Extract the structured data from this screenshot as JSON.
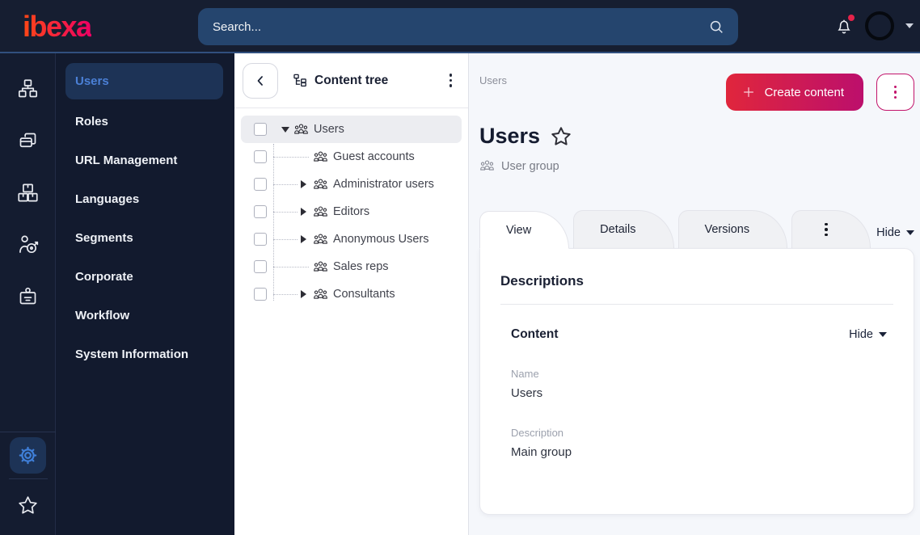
{
  "colors": {
    "topbar_bg": "#161e31",
    "topbar_divider": "#31507f",
    "rail_bg": "#141c30",
    "sidebar_bg": "#121a2e",
    "active_item_bg": "#1d3356",
    "active_item_text": "#4b80d6",
    "brand_gradient_start": "#ff4716",
    "brand_gradient_end": "#ed0064",
    "button_gradient_start": "#e0263c",
    "button_gradient_end": "#bc0f6c",
    "accent_magenta": "#c2136b",
    "notification_dot": "#e5234a",
    "main_bg": "#f5f7fb",
    "tree_selected_bg": "#ecedf1"
  },
  "topbar": {
    "logo_text": "ibexa",
    "search_placeholder": "Search...",
    "icons": [
      "search-icon",
      "bell-icon",
      "avatar",
      "chevron-down-icon"
    ]
  },
  "icon_rail": {
    "items": [
      {
        "icon": "sitemap-icon"
      },
      {
        "icon": "pages-icon"
      },
      {
        "icon": "packages-icon"
      },
      {
        "icon": "personalization-target-icon"
      },
      {
        "icon": "id-badge-icon"
      }
    ],
    "bottom": [
      {
        "icon": "gear-icon",
        "active": true
      },
      {
        "icon": "star-icon"
      }
    ]
  },
  "sidebar": {
    "items": [
      {
        "label": "Users",
        "active": true
      },
      {
        "label": "Roles"
      },
      {
        "label": "URL Management"
      },
      {
        "label": "Languages"
      },
      {
        "label": "Segments"
      },
      {
        "label": "Corporate"
      },
      {
        "label": "Workflow"
      },
      {
        "label": "System Information"
      }
    ]
  },
  "content_tree": {
    "title": "Content tree",
    "items": [
      {
        "label": "Users",
        "depth": 0,
        "state": "expanded",
        "selected": true,
        "icon": "user-group-icon"
      },
      {
        "label": "Guest accounts",
        "depth": 1,
        "state": "leaf",
        "icon": "user-group-icon"
      },
      {
        "label": "Administrator users",
        "depth": 1,
        "state": "collapsed",
        "icon": "user-group-icon"
      },
      {
        "label": "Editors",
        "depth": 1,
        "state": "collapsed",
        "icon": "user-group-icon"
      },
      {
        "label": "Anonymous Users",
        "depth": 1,
        "state": "collapsed",
        "icon": "user-group-icon"
      },
      {
        "label": "Sales reps",
        "depth": 1,
        "state": "leaf",
        "icon": "user-group-icon"
      },
      {
        "label": "Consultants",
        "depth": 1,
        "state": "collapsed",
        "icon": "user-group-icon"
      }
    ]
  },
  "main": {
    "breadcrumb": "Users",
    "create_button_label": "Create content",
    "page_title": "Users",
    "content_type_label": "User group",
    "tabs": [
      {
        "label": "View",
        "active": true
      },
      {
        "label": "Details"
      },
      {
        "label": "Versions"
      }
    ],
    "tabs_hide_label": "Hide",
    "card": {
      "heading": "Descriptions",
      "section_heading": "Content",
      "section_hide_label": "Hide",
      "fields": [
        {
          "label": "Name",
          "value": "Users"
        },
        {
          "label": "Description",
          "value": "Main group"
        }
      ]
    }
  }
}
